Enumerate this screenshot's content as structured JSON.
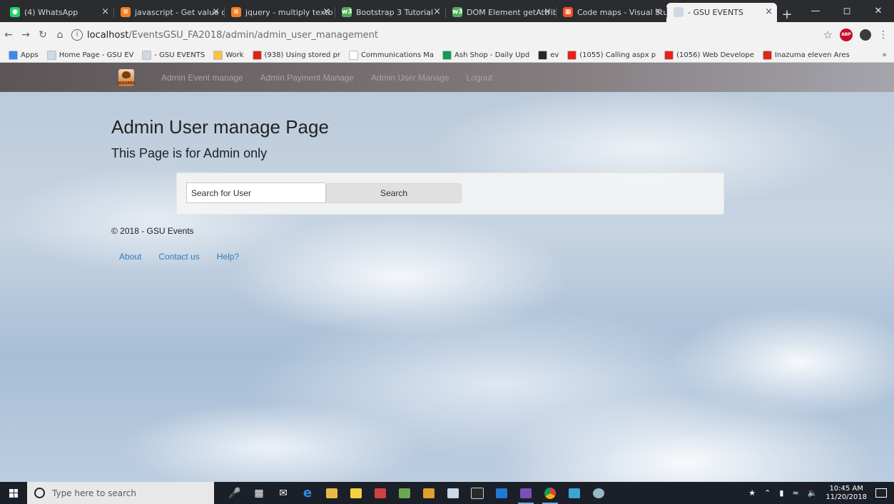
{
  "browser": {
    "tabs": [
      {
        "title": "(4) WhatsApp",
        "icon": "whatsapp-icon",
        "color": "#25d366",
        "glyph": "●"
      },
      {
        "title": "javascript - Get value o",
        "icon": "stackoverflow-icon",
        "color": "#f48024",
        "glyph": "≡"
      },
      {
        "title": "jquery - multiply textb",
        "icon": "stackoverflow-icon",
        "color": "#f48024",
        "glyph": "≡"
      },
      {
        "title": "Bootstrap 3 Tutorial",
        "icon": "w3schools-icon",
        "color": "#4caf50",
        "glyph": "w3"
      },
      {
        "title": "DOM Element getAttrib",
        "icon": "w3schools-icon",
        "color": "#4caf50",
        "glyph": "w3"
      },
      {
        "title": "Code maps - Visual Stu",
        "icon": "microsoft-icon",
        "color": "#f25022",
        "glyph": "▦"
      },
      {
        "title": "- GSU EVENTS",
        "icon": "page-icon",
        "color": "#cfd8e3",
        "glyph": ""
      }
    ],
    "address": {
      "host": "localhost",
      "path": "/EventsGSU_FA2018/admin/admin_user_management"
    },
    "bookmarks": [
      {
        "label": "Apps",
        "icon": "apps-grid-icon",
        "color": "#4285f4"
      },
      {
        "label": "Home Page - GSU EV",
        "icon": "page-icon",
        "color": "#cfd8e3"
      },
      {
        "label": "- GSU EVENTS",
        "icon": "page-icon",
        "color": "#cfd8e3"
      },
      {
        "label": "Work",
        "icon": "folder-icon",
        "color": "#f5c542"
      },
      {
        "label": "(938) Using stored pr",
        "icon": "youtube-icon",
        "color": "#e62117"
      },
      {
        "label": "Communications Ma",
        "icon": "doc-icon",
        "color": "#ffffff"
      },
      {
        "label": "Ash Shop - Daily Upd",
        "icon": "sheets-icon",
        "color": "#0f9d58"
      },
      {
        "label": "ev",
        "icon": "github-icon",
        "color": "#24292e"
      },
      {
        "label": "(1055) Calling aspx p",
        "icon": "youtube-icon",
        "color": "#e62117"
      },
      {
        "label": "(1056) Web Develope",
        "icon": "youtube-icon",
        "color": "#e62117"
      },
      {
        "label": "Inazuma eleven Ares",
        "icon": "youtube-icon",
        "color": "#e62117"
      }
    ],
    "bookmarks_more": "»"
  },
  "site": {
    "brand_text": "JAGUARS",
    "nav": [
      "Admin Event manage",
      "Admin Payment Manage",
      "Admin User Manage",
      "Logout"
    ],
    "title": "Admin User manage Page",
    "subtitle": "This Page is for Admin only",
    "search": {
      "placeholder": "Search for User",
      "button": "Search"
    },
    "footer": {
      "copyright": "© 2018 - GSU Events",
      "links": [
        "About",
        "Contact us",
        "Help?"
      ]
    }
  },
  "taskbar": {
    "search_placeholder": "Type here to search",
    "time": "10:45 AM",
    "date": "11/20/2018"
  }
}
